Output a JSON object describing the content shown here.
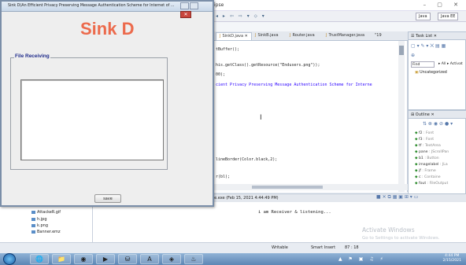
{
  "eclipse": {
    "title": "ipse",
    "window_controls": "–  ▢  ✕",
    "perspective_java": "Java",
    "perspective_javaee": "Java EE",
    "tabs": [
      {
        "label": "SinkD.java",
        "active": true
      },
      {
        "label": "SinkB.java",
        "active": false
      },
      {
        "label": "Router.java",
        "active": false
      },
      {
        "label": "TrustManager.java",
        "active": false
      },
      {
        "label": "\"19",
        "active": false
      }
    ],
    "code_lines": [
      "tBuffer();",
      "his.getClass().getResource(\"Endusers.png\"));",
      "00);",
      "cient Privacy Preserving Message Authentication Scheme for Interne",
      "lineBorder(Color.black,2);",
      "r(bl);"
    ],
    "task_list": {
      "title": "Task List",
      "find_label": "Find",
      "all_label": "All",
      "activate_label": "Activat",
      "uncategorized": "Uncategorized"
    },
    "outline": {
      "title": "Outline",
      "items": [
        {
          "name": "f2",
          "type": "Font"
        },
        {
          "name": "f3",
          "type": "Font"
        },
        {
          "name": "tf",
          "type": "TextArea"
        },
        {
          "name": "pane",
          "type": "JScrollPan"
        },
        {
          "name": "b1",
          "type": "Button"
        },
        {
          "name": "imagelabel",
          "type": "JLa"
        },
        {
          "name": "jf",
          "type": "Frame"
        },
        {
          "name": "c",
          "type": "Containe"
        },
        {
          "name": "fout",
          "type": "FileOutput"
        }
      ]
    },
    "console": {
      "header": "we.exe (Feb 15, 2021 4:44:49 PM)",
      "text": "i am Receiver & listening..."
    },
    "project_tree": [
      "AttackeR.gif",
      "h.jpg",
      "k.png",
      "Banner.emz"
    ],
    "status": {
      "writable": "Writable",
      "insert_mode": "Smart Insert",
      "position": "87 : 18"
    },
    "watermark_title": "Activate Windows",
    "watermark_sub": "Go to Settings to activate Windows."
  },
  "taskbar": {
    "clock_time": "4:44 PM",
    "clock_date": "2/15/2021"
  },
  "sink_dialog": {
    "title": "Sink D(An Efficient Privacy Preserving Message Authentication Scheme for Internet of ...",
    "heading": "Sink D",
    "panel_label": "File Receiving",
    "textarea_value": "",
    "save_label": "save"
  }
}
